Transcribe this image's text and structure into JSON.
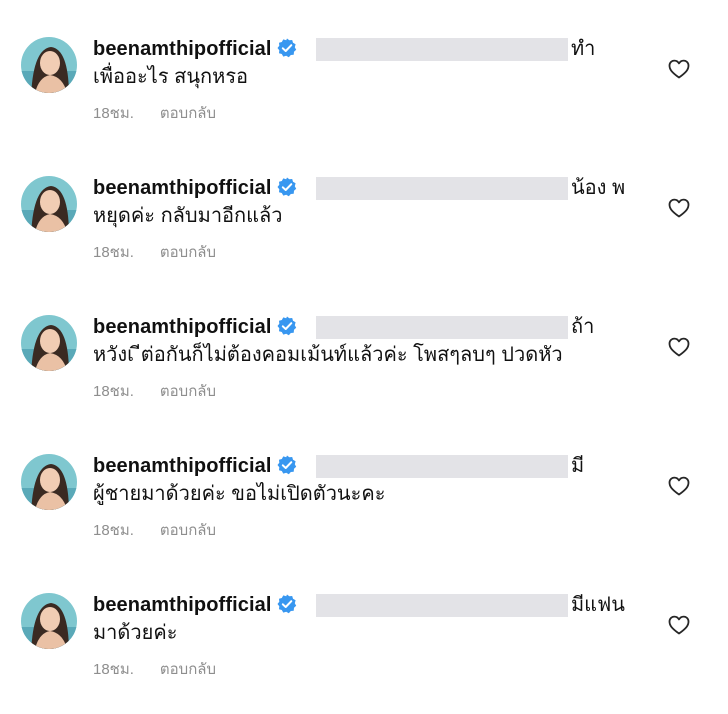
{
  "username": "beenamthipofficial",
  "reply_label": "ตอบกลับ",
  "comments": [
    {
      "tail": "ทำ",
      "line2": "เพื่ออะไร สนุกหรอ",
      "time": "18ชม."
    },
    {
      "tail": "น้อง พ",
      "line2": "หยุดค่ะ กลับมาอีกแล้ว",
      "time": "18ชม."
    },
    {
      "tail": "ถ้า",
      "line2": "หวังเ ีต่อกันก็ไม่ต้องคอมเม้นท์แล้วค่ะ โพสๆลบๆ ปวดหัว",
      "time": "18ชม."
    },
    {
      "tail": "มี",
      "line2": "ผู้ชายมาด้วยค่ะ ขอไม่เปิดตัวนะคะ",
      "time": "18ชม."
    },
    {
      "tail": "มีแฟน",
      "line2": "มาด้วยค่ะ",
      "time": "18ชม."
    }
  ],
  "colors": {
    "verified": "#3897f0",
    "meta": "#8e8e8e",
    "redaction": "#e3e3e7"
  },
  "icons": {
    "verified": "verified-badge-icon",
    "like": "heart-outline-icon"
  }
}
